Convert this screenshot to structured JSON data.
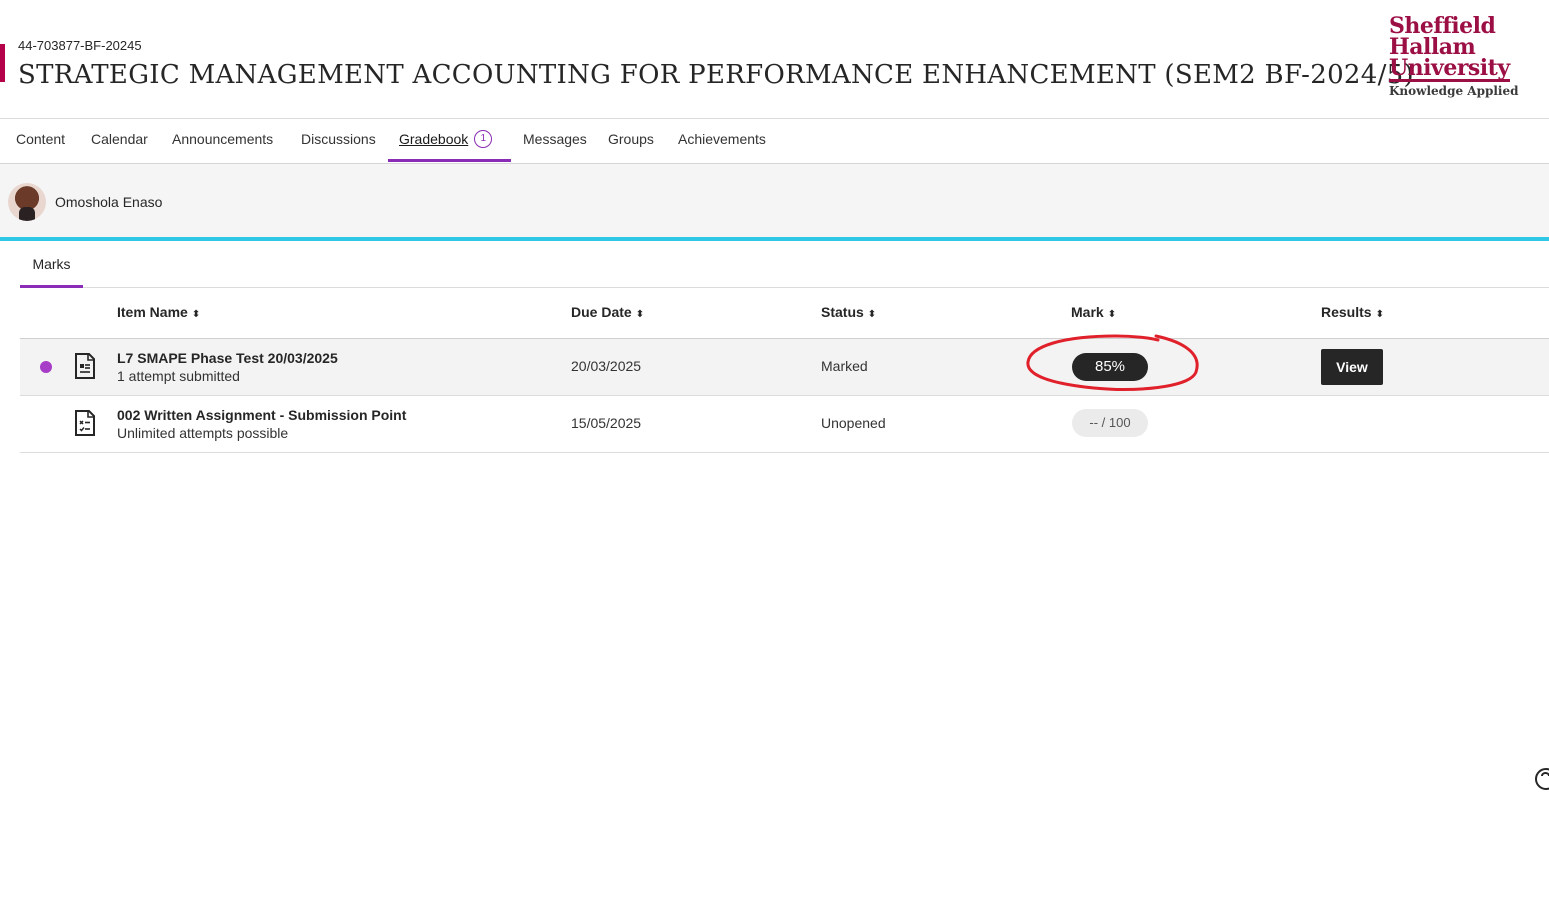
{
  "header": {
    "course_code": "44-703877-BF-20245",
    "course_title": "STRATEGIC MANAGEMENT ACCOUNTING FOR PERFORMANCE ENHANCEMENT (SEM2 BF-2024/5)",
    "logo": {
      "line1": "Sheffield",
      "line2": "Hallam",
      "line3": "University",
      "tagline": "Knowledge Applied"
    }
  },
  "nav": {
    "items": [
      {
        "label": "Content"
      },
      {
        "label": "Calendar"
      },
      {
        "label": "Announcements"
      },
      {
        "label": "Discussions"
      },
      {
        "label": "Gradebook",
        "badge": "1",
        "active": true
      },
      {
        "label": "Messages"
      },
      {
        "label": "Groups"
      },
      {
        "label": "Achievements"
      }
    ]
  },
  "user": {
    "name": "Omoshola Enaso"
  },
  "subtabs": {
    "marks": "Marks"
  },
  "table": {
    "headers": {
      "item_name": "Item Name",
      "due_date": "Due Date",
      "status": "Status",
      "mark": "Mark",
      "results": "Results"
    },
    "rows": [
      {
        "title": "L7 SMAPE Phase Test 20/03/2025",
        "subtitle": "1 attempt submitted",
        "due_date": "20/03/2025",
        "status": "Marked",
        "mark": "85%",
        "results": "View",
        "new": true
      },
      {
        "title": "002 Written Assignment - Submission Point",
        "subtitle": "Unlimited attempts possible",
        "due_date": "15/05/2025",
        "status": "Unopened",
        "mark": "-- / 100",
        "results": ""
      }
    ]
  },
  "colors": {
    "accent": "#8a2cb5",
    "brand": "#9c0f45",
    "user_line": "#2ec8e6",
    "annotation": "#e0202a"
  },
  "icons": [
    "document-icon",
    "sort-icon",
    "help-icon"
  ]
}
